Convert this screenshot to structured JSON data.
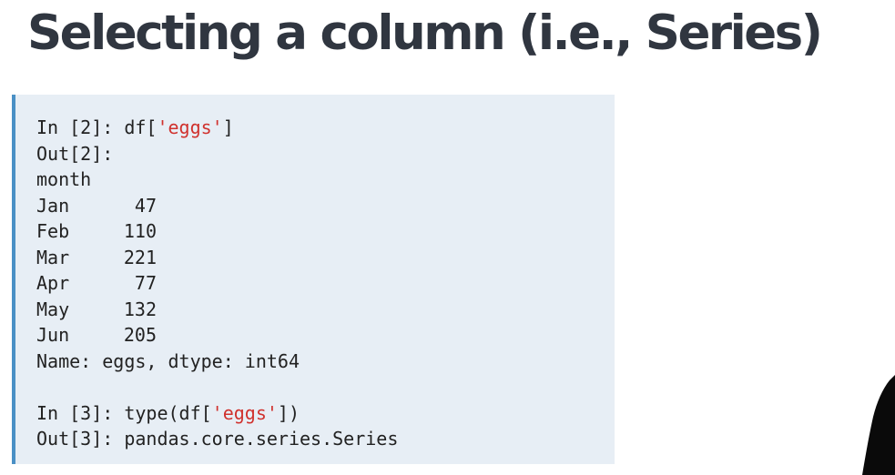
{
  "slide": {
    "title": "Selecting a column (i.e., Series)"
  },
  "code": {
    "cell1": {
      "in_prefix": "In [2]: df[",
      "in_string": "'eggs'",
      "in_suffix": "]",
      "out_label": "Out[2]:",
      "index_name": "month",
      "rows": [
        {
          "label": "Jan",
          "value": "47"
        },
        {
          "label": "Feb",
          "value": "110"
        },
        {
          "label": "Mar",
          "value": "221"
        },
        {
          "label": "Apr",
          "value": "77"
        },
        {
          "label": "May",
          "value": "132"
        },
        {
          "label": "Jun",
          "value": "205"
        }
      ],
      "footer": "Name: eggs, dtype: int64"
    },
    "cell2": {
      "in_prefix": "In [3]: type(df[",
      "in_string": "'eggs'",
      "in_suffix": "])",
      "out_text": "Out[3]: pandas.core.series.Series"
    }
  },
  "colors": {
    "panel_background": "#e7eef5",
    "panel_accent": "#4a90c5",
    "string_literal": "#d0312d",
    "title_text": "#303640"
  }
}
